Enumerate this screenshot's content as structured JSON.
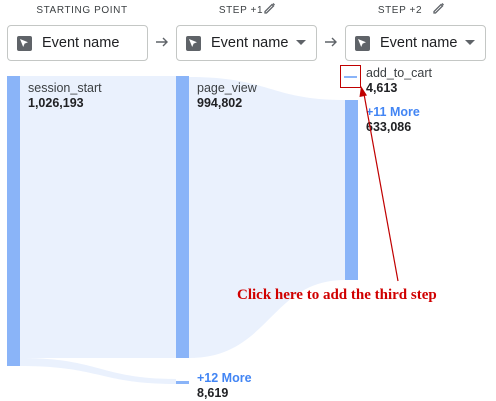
{
  "headers": {
    "starting_point": "STARTING POINT",
    "step1": "STEP +1",
    "step2": "STEP +2"
  },
  "pickers": [
    {
      "label": "Event name",
      "has_dropdown": false
    },
    {
      "label": "Event name",
      "has_dropdown": true
    },
    {
      "label": "Event name",
      "has_dropdown": true
    }
  ],
  "nodes": {
    "session_start": {
      "name": "session_start",
      "value": "1,026,193"
    },
    "page_view": {
      "name": "page_view",
      "value": "994,802"
    },
    "more_step1": {
      "label": "+12 More",
      "value": "8,619"
    },
    "add_to_cart": {
      "name": "add_to_cart",
      "value": "4,613"
    },
    "more_step2": {
      "label": "+11 More",
      "value": "633,086"
    }
  },
  "annotation": {
    "text": "Click here to add the third step",
    "color": "#d00000"
  },
  "colors": {
    "bar": "#8ab4f8",
    "flow": "#eaf1fd",
    "more_link": "#4285f4"
  },
  "icons": [
    "pencil-icon",
    "arrow-right-icon",
    "cursor-select-icon",
    "chevron-down-icon"
  ]
}
